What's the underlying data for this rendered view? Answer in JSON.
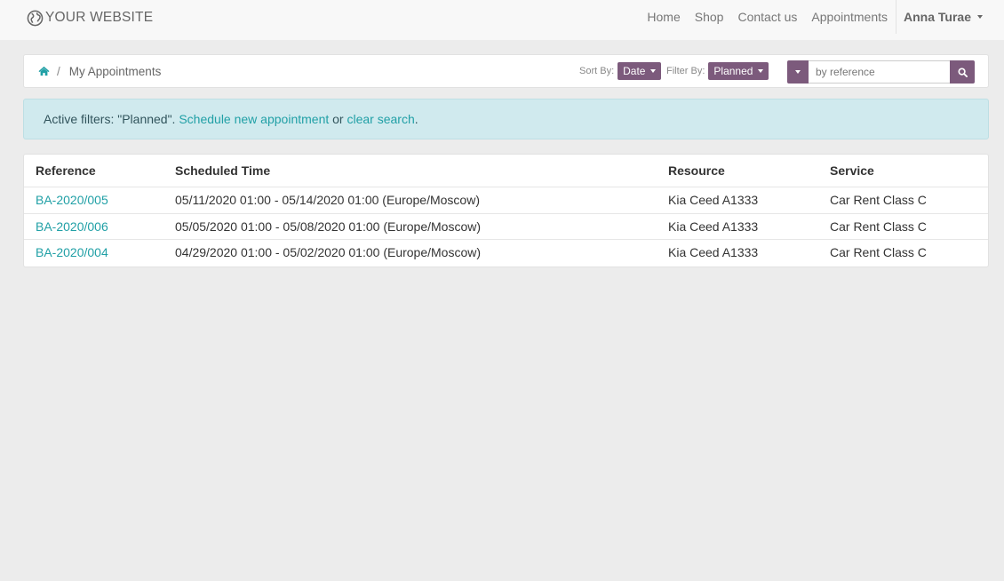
{
  "brand": {
    "name": "YOUR WEBSITE",
    "icon": "globe-icon"
  },
  "nav": {
    "links": [
      "Home",
      "Shop",
      "Contact us",
      "Appointments"
    ],
    "user": "Anna Turae"
  },
  "breadcrumb": {
    "home_icon": "home-icon",
    "separator": "/",
    "current": "My Appointments"
  },
  "sort": {
    "label": "Sort By:",
    "value": "Date"
  },
  "filter": {
    "label": "Filter By:",
    "value": "Planned"
  },
  "search": {
    "placeholder": "by reference",
    "button_icon": "search-icon"
  },
  "alert": {
    "prefix": "Active filters: \"Planned\". ",
    "schedule_link": "Schedule new appointment",
    "middle": " or ",
    "clear_link": "clear search",
    "suffix": "."
  },
  "table": {
    "columns": [
      "Reference",
      "Scheduled Time",
      "Resource",
      "Service"
    ],
    "rows": [
      {
        "reference": "BA-2020/005",
        "scheduled": "05/11/2020 01:00 - 05/14/2020 01:00 (Europe/Moscow)",
        "resource": "Kia Ceed A1333",
        "service": "Car Rent Class C"
      },
      {
        "reference": "BA-2020/006",
        "scheduled": "05/05/2020 01:00 - 05/08/2020 01:00 (Europe/Moscow)",
        "resource": "Kia Ceed A1333",
        "service": "Car Rent Class C"
      },
      {
        "reference": "BA-2020/004",
        "scheduled": "04/29/2020 01:00 - 05/02/2020 01:00 (Europe/Moscow)",
        "resource": "Kia Ceed A1333",
        "service": "Car Rent Class C"
      }
    ]
  },
  "colors": {
    "accent": "#7c5a7c",
    "link": "#21a0a6",
    "alert_bg": "#d0eaee",
    "page_bg": "#ececec"
  }
}
